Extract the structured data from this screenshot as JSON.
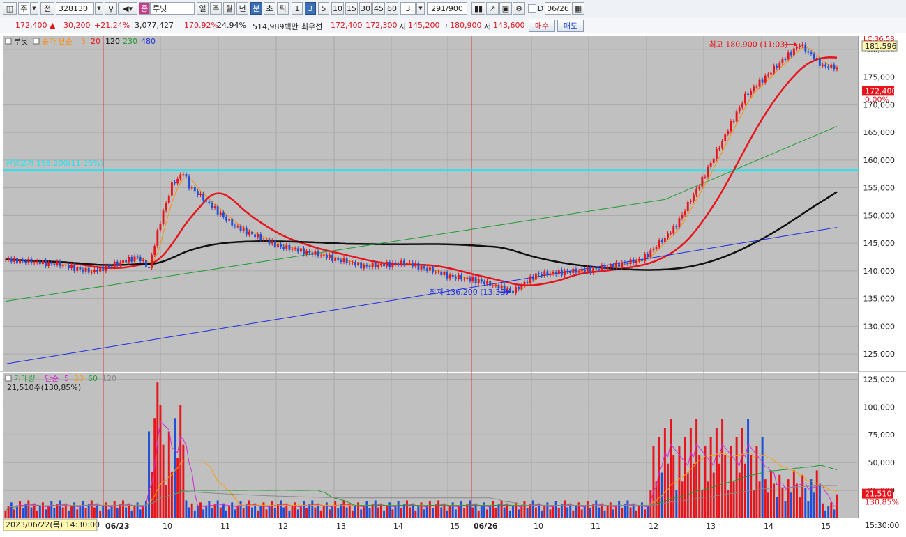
{
  "toolbar": {
    "market_select": "주",
    "prev_label": "전",
    "code": "328130",
    "stock_name": "루닛",
    "periods": [
      "일",
      "주",
      "월",
      "년",
      "분",
      "초",
      "틱"
    ],
    "period_selected": "분",
    "intervals": [
      "1",
      "3",
      "5",
      "10",
      "15",
      "30",
      "45",
      "60"
    ],
    "interval_selected": "3",
    "interval_input": "3",
    "count": "291",
    "count_total": "/900",
    "date_checkbox_label": "D",
    "date": "06/26"
  },
  "quote": {
    "price": "172,400",
    "change": "30,200",
    "change_pct": "+21.24%",
    "volume": "3,077,427",
    "vol_ratio": "170.92%",
    "turnover": "24.94%",
    "amount": "514,989백만",
    "best_label": "최우선",
    "ask": "172,400",
    "bid": "172,300",
    "open_label": "시",
    "open": "145,200",
    "high_label": "고",
    "high": "180,900",
    "low_label": "저",
    "low": "143,600",
    "buy_button": "매수",
    "sell_button": "매도"
  },
  "price_panel": {
    "title": "루닛",
    "legend_label": "종가 단순",
    "ma_periods": [
      "5",
      "20",
      "120",
      "230",
      "480"
    ],
    "ma_colors": [
      "#ff8c00",
      "#e8141b",
      "#111111",
      "#1e9a2e",
      "#1f2ee0"
    ],
    "high_annotation": "최고 180,900 (11:03)",
    "low_annotation": "최저 136,200 (13:39)",
    "prev_high_label": "전일고가 158,200(11.25%)",
    "current_label": "172,400",
    "current_pct": "0.00%",
    "top_marker": "181,596",
    "corner_label": "LC:36.58",
    "y_ticks": [
      "180,000",
      "175,000",
      "170,000",
      "165,000",
      "160,000",
      "155,000",
      "150,000",
      "145,000",
      "140,000",
      "135,000",
      "130,000",
      "125,000"
    ],
    "y_values": [
      180000,
      175000,
      170000,
      165000,
      160000,
      155000,
      150000,
      145000,
      140000,
      135000,
      130000,
      125000
    ],
    "colors": {
      "up": "#e8141b",
      "down": "#1f4fd6",
      "prev_high": "#22e4f0"
    }
  },
  "volume_panel": {
    "title": "거래량",
    "legend_label": "단순",
    "ma_periods": [
      "5",
      "20",
      "60",
      "120"
    ],
    "ma_colors": [
      "#d22bd2",
      "#ff9c00",
      "#1e9a2e",
      "#888888"
    ],
    "info": "21,510주(130,85%)",
    "current_label": "21,510",
    "current_pct": "130.85%",
    "y_ticks": [
      "125,000",
      "100,000",
      "75,000",
      "50,000",
      "25,000"
    ],
    "y_values": [
      125000,
      100000,
      75000,
      50000,
      25000
    ]
  },
  "x_axis": {
    "datetime_box": "2023/06/22(목) 14:30:00",
    "labels": [
      "06/23",
      "10",
      "11",
      "12",
      "13",
      "14",
      "15",
      "06/26",
      "10",
      "11",
      "12",
      "13",
      "14",
      "15"
    ],
    "time_box": "15:30:00"
  },
  "chart_data": {
    "type": "candlestick",
    "price_range": [
      122000,
      182500
    ],
    "volume_range": [
      0,
      125000
    ],
    "key_points": [
      {
        "label": "start",
        "value": 142000
      },
      {
        "label": "prev_high",
        "value": 158200
      },
      {
        "label": "day_low",
        "value": 136200
      },
      {
        "label": "day_high",
        "value": 180900
      },
      {
        "label": "last",
        "value": 172400
      }
    ],
    "last_volume": 21510
  }
}
